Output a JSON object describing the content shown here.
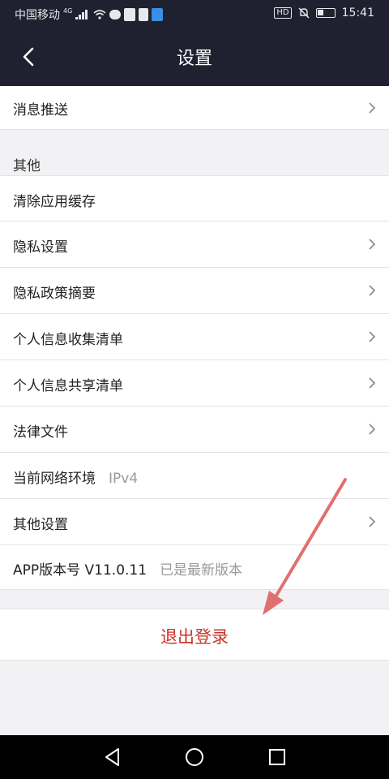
{
  "status_bar": {
    "carrier": "中国移动",
    "network": "4G",
    "hd_badge": "HD",
    "time": "15:41"
  },
  "nav": {
    "title": "设置"
  },
  "rows": [
    {
      "label": "消息推送",
      "has_chevron": true
    },
    {
      "label": "清除应用缓存",
      "has_chevron": false
    },
    {
      "label": "隐私设置",
      "has_chevron": true
    },
    {
      "label": "隐私政策摘要",
      "has_chevron": true
    },
    {
      "label": "个人信息收集清单",
      "has_chevron": true
    },
    {
      "label": "个人信息共享清单",
      "has_chevron": true
    },
    {
      "label": "法律文件",
      "has_chevron": true
    },
    {
      "label": "当前网络环境",
      "value": "IPv4",
      "has_chevron": false
    },
    {
      "label": "其他设置",
      "has_chevron": true
    },
    {
      "label": "APP版本号 V11.0.11",
      "value": "已是最新版本",
      "has_chevron": false
    }
  ],
  "section_other": "其他",
  "logout_label": "退出登录",
  "colors": {
    "header_bg": "#1f2130",
    "logout_text": "#c8352a",
    "annotation_arrow": "#e07070"
  },
  "icons": [
    "back-icon",
    "chevron-right-icon",
    "signal-icon",
    "wifi-icon",
    "battery-icon",
    "mute-icon",
    "nav-back-icon",
    "nav-home-icon",
    "nav-recents-icon"
  ]
}
